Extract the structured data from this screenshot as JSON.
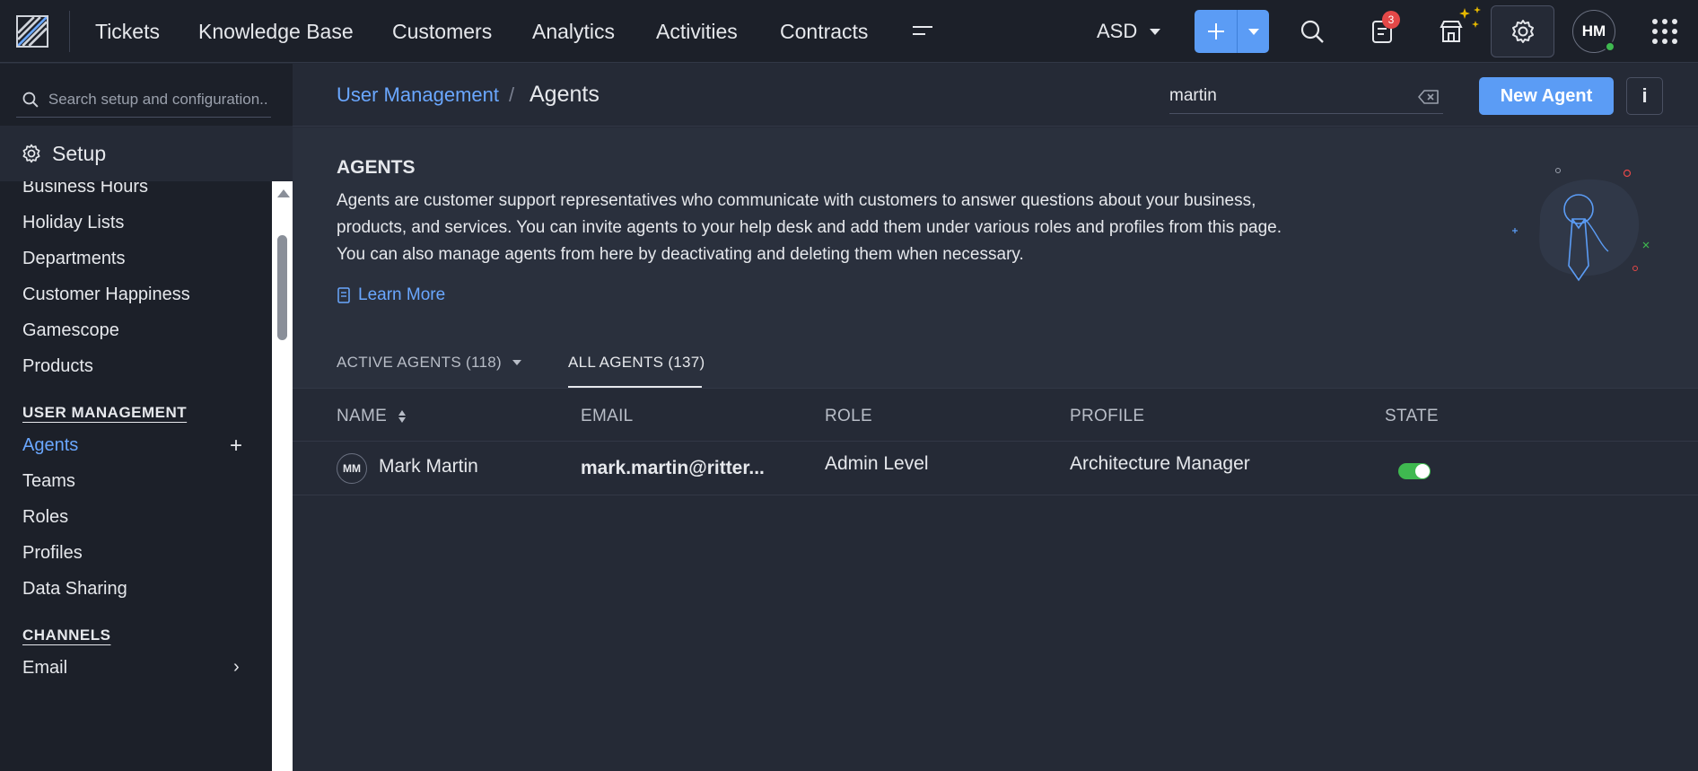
{
  "topbar": {
    "nav": [
      "Tickets",
      "Knowledge Base",
      "Customers",
      "Analytics",
      "Activities",
      "Contracts"
    ],
    "org": "ASD",
    "notification_count": "3",
    "avatar_initials": "HM"
  },
  "sidebar": {
    "search_placeholder": "Search setup and configuration..",
    "setup_label": "Setup",
    "items_general": [
      "Business Hours",
      "Holiday Lists",
      "Departments",
      "Customer Happiness",
      "Gamescope",
      "Products"
    ],
    "section_user_management": "USER MANAGEMENT",
    "items_user_management": [
      "Agents",
      "Teams",
      "Roles",
      "Profiles",
      "Data Sharing"
    ],
    "section_channels": "CHANNELS",
    "items_channels": [
      "Email"
    ]
  },
  "header": {
    "breadcrumb_parent": "User Management",
    "breadcrumb_separator": "/",
    "breadcrumb_current": "Agents",
    "search_value": "martin",
    "new_agent_label": "New Agent",
    "info_label": "i"
  },
  "intro": {
    "title": "AGENTS",
    "description": "Agents are customer support representatives who communicate with customers to answer questions about your business, products, and services. You can invite agents to your help desk and add them under various roles and profiles from this page. You can also manage agents from here by deactivating and deleting them when necessary.",
    "learn_more": "Learn More"
  },
  "tabs": {
    "active_agents": "ACTIVE AGENTS (118)",
    "all_agents": "ALL AGENTS (137)"
  },
  "table": {
    "columns": [
      "NAME",
      "EMAIL",
      "ROLE",
      "PROFILE",
      "STATE"
    ],
    "rows": [
      {
        "initials": "MM",
        "name": "Mark Martin",
        "email": "mark.martin@ritter...",
        "role": "Admin Level",
        "profile": "Architecture Manager",
        "state_on": true
      }
    ]
  },
  "colors": {
    "accent": "#5b9cf5",
    "link": "#6aa7ff",
    "toggle_on": "#3fb950",
    "badge": "#e44848"
  }
}
